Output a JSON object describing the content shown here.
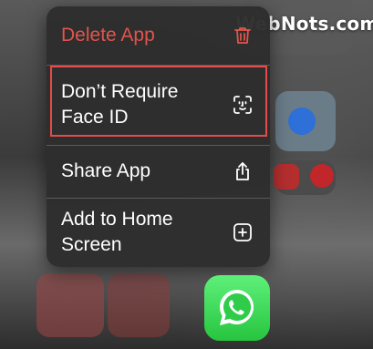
{
  "watermark": "WebNots.com",
  "context_menu": {
    "items": [
      {
        "label": "Delete App",
        "icon": "trash-icon",
        "destructive": true
      },
      {
        "label": "Don’t Require\nFace ID",
        "icon": "face-id-icon",
        "highlighted": true
      },
      {
        "label": "Share App",
        "icon": "share-icon"
      },
      {
        "label": "Add to Home\nScreen",
        "icon": "add-square-icon"
      }
    ]
  },
  "app": {
    "name": "WhatsApp",
    "icon": "whatsapp-icon"
  },
  "colors": {
    "destructive": "#e0554c",
    "highlight_border": "#e64a4a",
    "menu_background": "#2d2d2d",
    "whatsapp_green": "#27c53f"
  }
}
